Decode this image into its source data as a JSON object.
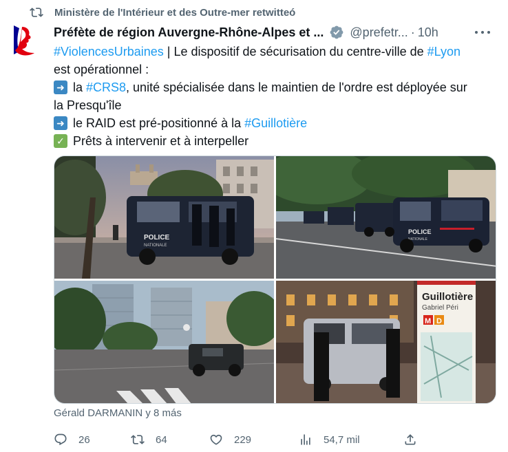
{
  "retweet_by": "Ministère de l'Intérieur et des Outre-mer retwitteó",
  "author": {
    "name": "Préfète de région Auvergne-Rhône-Alpes et ...",
    "handle": "@prefetr...",
    "separator": "·",
    "time": "10h"
  },
  "text": {
    "l1_tag1": "#ViolencesUrbaines",
    "l1_text": " | Le dispositif de sécurisation du centre-ville de ",
    "l1_tag2": "#Lyon",
    "l2": "est opérationnel :",
    "l3_pre": "la ",
    "l3_tag": "#CRS8",
    "l3_post": ", unité spécialisée dans le maintien de l'ordre est déployée sur",
    "l4": "la Presqu'île",
    "l5_pre": "le RAID est pré-positionné à la ",
    "l5_tag": "#Guillotière",
    "l6": "Prêts à intervenir et à interpeller"
  },
  "photos": {
    "p1_van_label": "POLICE",
    "p1_van_sub": "NATIONALE",
    "p2_van_label": "POLICE",
    "p2_van_sub": "NATIONALE",
    "p4_sign_title": "Guillotière",
    "p4_sign_sub": "Gabriel Péri",
    "p4_sign_m": "M",
    "p4_sign_d": "D"
  },
  "tagged": "Gérald DARMANIN y 8 más",
  "actions": {
    "replies": "26",
    "retweets": "64",
    "likes": "229",
    "views": "54,7 mil"
  },
  "colors": {
    "accent": "#1d9bf0",
    "muted": "#536471",
    "verified": "#829aab"
  }
}
